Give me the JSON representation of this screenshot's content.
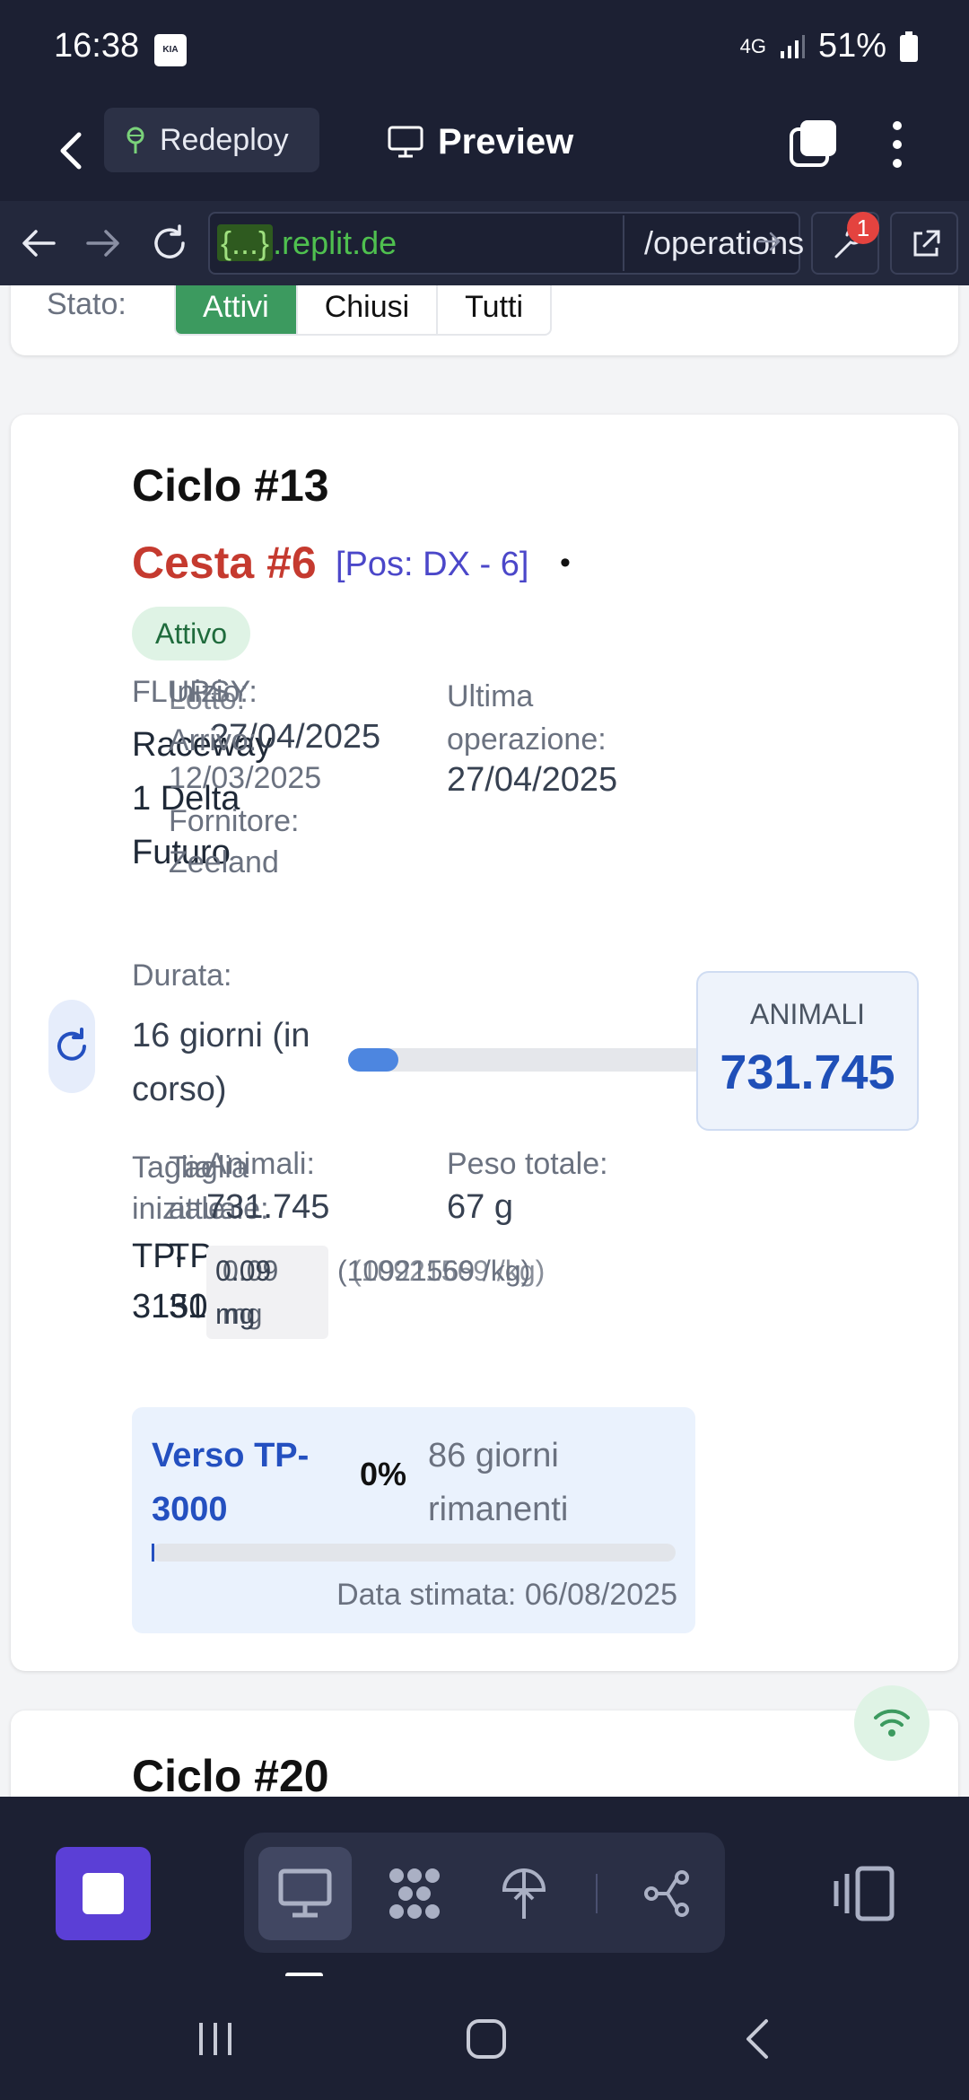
{
  "status_bar": {
    "time": "16:38",
    "carrier_badge": "KIA Connect",
    "network": "4G",
    "battery": "51%"
  },
  "app_bar": {
    "redeploy_label": "Redeploy",
    "preview_label": "Preview"
  },
  "url_bar": {
    "domain_highlight": "{...}",
    "domain_rest": ".replit.de",
    "path": "/operations",
    "devtools_badge": "1"
  },
  "filter": {
    "label": "Stato:",
    "options": [
      "Attivi",
      "Chiusi",
      "Tutti"
    ],
    "active": "Attivi"
  },
  "cycle": {
    "title": "Ciclo #13",
    "basket": "Cesta #6",
    "position": "[Pos: DX - 6]",
    "dot": "•",
    "status": "Attivo",
    "flupsy_label": "FLUPSY:",
    "flupsy_value": "Raceway 1 Delta Futuro",
    "inizio_label": "Inizio:",
    "inizio_value": "27/04/2025",
    "lotto_label": "Lotto:",
    "arrivo_label": "Arrivo:",
    "arrivo_value": "12/03/2025",
    "fornitore_label": "Fornitore:",
    "fornitore_value": "Zeeland",
    "ultima_label": "Ultima operazione:",
    "ultima_value": "27/04/2025",
    "durata_label": "Durata:",
    "durata_value": "16 giorni (in corso)",
    "durata_progress": 0.14,
    "animali_title": "ANIMALI",
    "animali_value": "731.745",
    "taglia_label": "Taglia iniziale:",
    "taglia_value": "TP-3150",
    "taglia_label_b": "Taglia attuale:",
    "taglia_value_b": "TP-3150",
    "animali_label": "Animali:",
    "animali_count": "731.745",
    "peso_medio": "0.09 mg",
    "peso_medio_b": "0.09 mg",
    "per_kg": "(10921569 /kg)",
    "per_kg_b": "(10921569 /kg)",
    "peso_totale_label": "Peso totale:",
    "peso_totale_value": "67 g",
    "target_label": "Verso TP-3000",
    "target_percent": "0%",
    "target_progress": 0.005,
    "target_remaining": "86 giorni rimanenti",
    "target_date": "Data stimata: 06/08/2025"
  },
  "next_cycle": {
    "title": "Ciclo #20"
  },
  "colors": {
    "accent_green": "#3c9a5f",
    "basket_red": "#c53a2f",
    "position_blue": "#4b47c9",
    "animali_blue": "#1f4fb8",
    "target_blue": "#2450c0"
  }
}
